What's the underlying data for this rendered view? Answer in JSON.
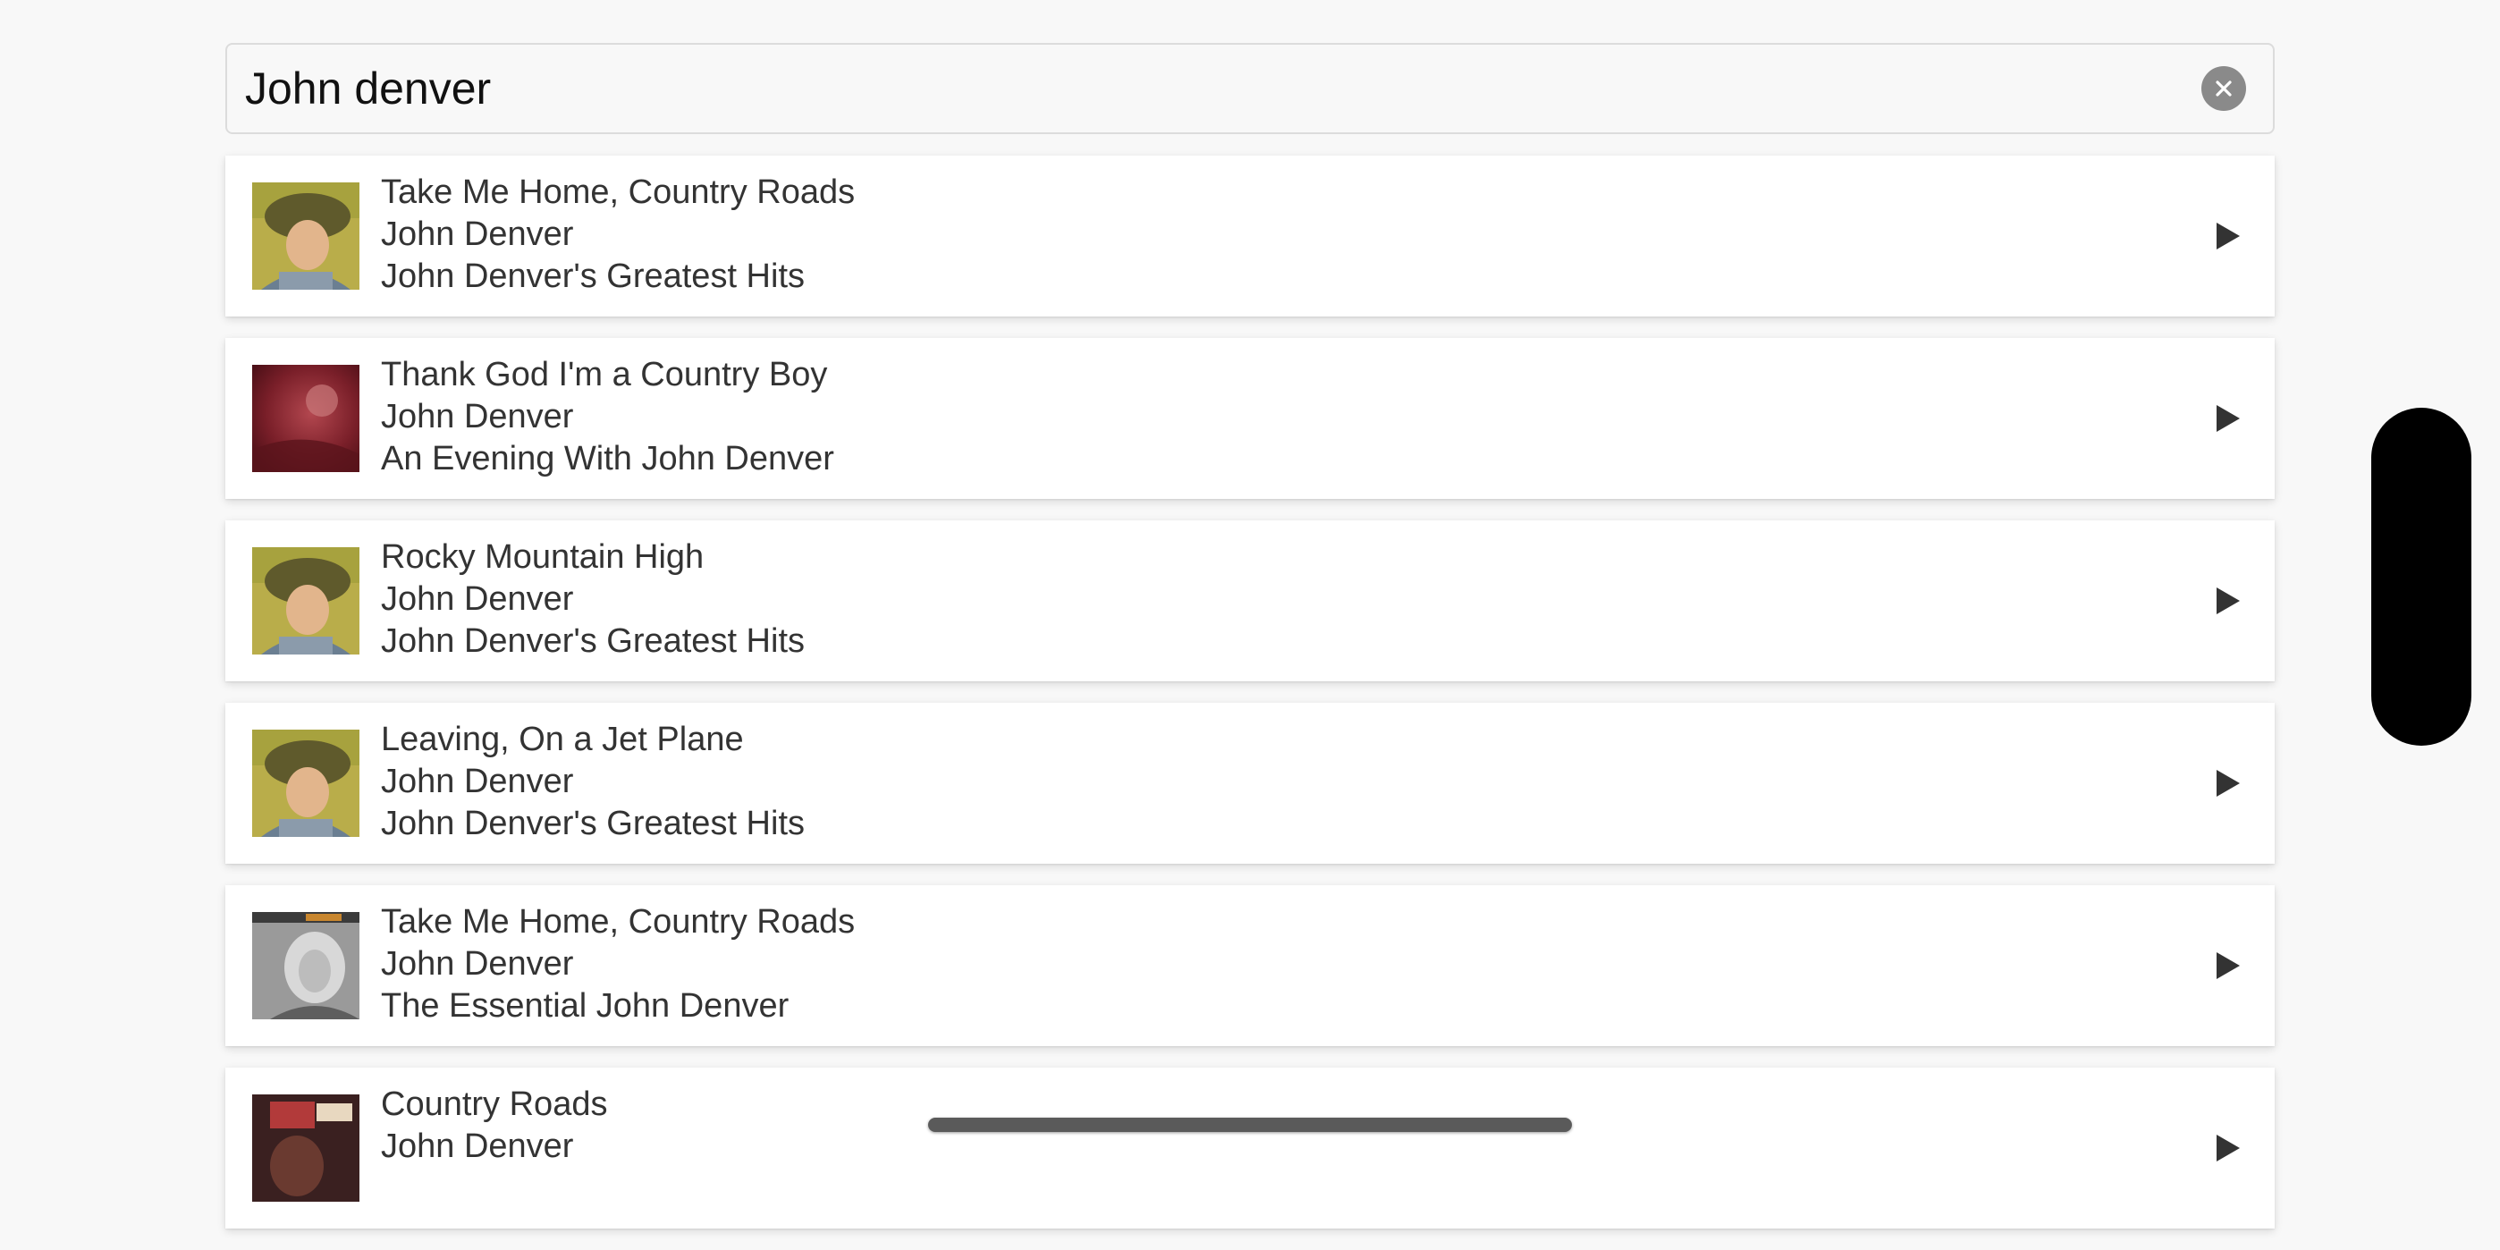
{
  "search": {
    "query": "John denver",
    "clear_icon": "clear-circle-icon"
  },
  "results": [
    {
      "title": "Take Me Home, Country Roads",
      "artist": "John Denver",
      "album": "John Denver's Greatest Hits",
      "cover_art": "greatest-hits-cover",
      "action_icon": "play-icon"
    },
    {
      "title": "Thank God I'm a Country Boy",
      "artist": "John Denver",
      "album": "An Evening With John Denver",
      "cover_art": "evening-with-cover",
      "action_icon": "play-icon"
    },
    {
      "title": "Rocky Mountain High",
      "artist": "John Denver",
      "album": "John Denver's Greatest Hits",
      "cover_art": "greatest-hits-cover",
      "action_icon": "play-icon"
    },
    {
      "title": "Leaving, On a Jet Plane",
      "artist": "John Denver",
      "album": "John Denver's Greatest Hits",
      "cover_art": "greatest-hits-cover",
      "action_icon": "play-icon"
    },
    {
      "title": "Take Me Home, Country Roads",
      "artist": "John Denver",
      "album": "The Essential John Denver",
      "cover_art": "essential-cover",
      "action_icon": "play-icon"
    },
    {
      "title": "Country Roads",
      "artist": "John Denver",
      "album": "",
      "cover_art": "country-roads-cover",
      "action_icon": "play-icon"
    }
  ],
  "colors": {
    "background": "#f8f8f8",
    "card": "#ffffff",
    "text": "#333333",
    "icon": "#333333",
    "clear_button": "#8a8a8a"
  }
}
